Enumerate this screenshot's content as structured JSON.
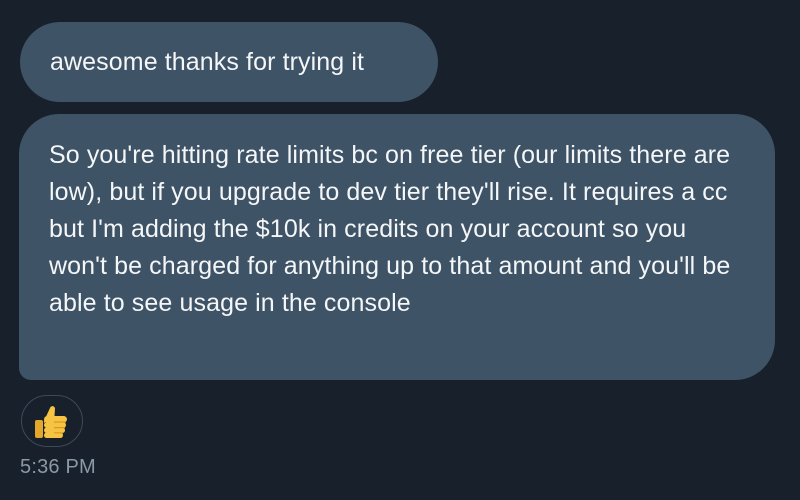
{
  "messages": [
    {
      "text": "awesome thanks for trying it"
    },
    {
      "text": "So you're hitting rate limits bc on free tier (our limits there are low), but if you upgrade to dev tier they'll rise. It requires a cc but I'm adding the $10k in credits on your account so you won't be charged for anything up to that amount and you'll be able to see usage in the console"
    }
  ],
  "reaction": {
    "icon": "thumbs-up-icon"
  },
  "timestamp": "5:36 PM",
  "colors": {
    "background": "#17202b",
    "bubble": "#3e5366",
    "text": "#f4f6f8",
    "timestamp": "#8b98a5",
    "reaction_border": "#3d4b59",
    "thumb": "#f6c343"
  }
}
